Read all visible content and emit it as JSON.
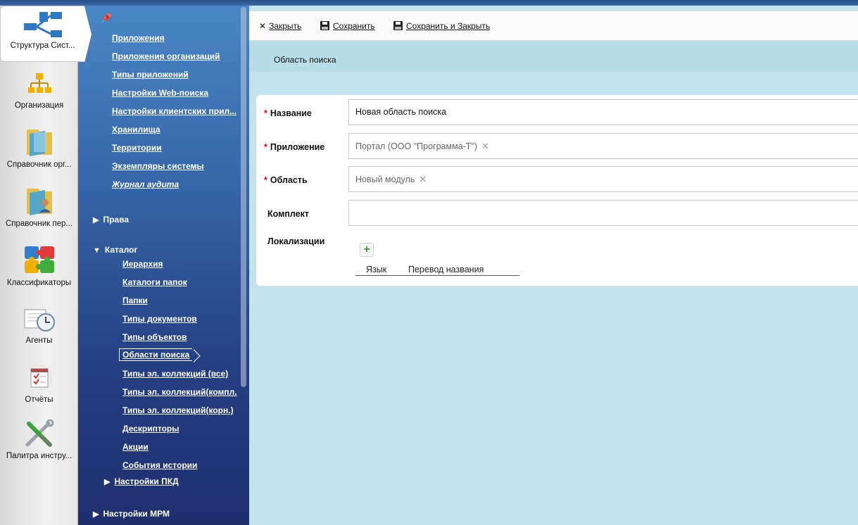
{
  "rail": {
    "items": [
      {
        "label": "Структура Сист...",
        "icon": "system-structure-icon"
      },
      {
        "label": "Организация",
        "icon": "organization-icon"
      },
      {
        "label": "Справочник орг...",
        "icon": "org-directory-icon"
      },
      {
        "label": "Справочник пер...",
        "icon": "personnel-directory-icon"
      },
      {
        "label": "Классификаторы",
        "icon": "classifiers-icon"
      },
      {
        "label": "Агенты",
        "icon": "agents-icon"
      },
      {
        "label": "Отчёты",
        "icon": "reports-icon"
      },
      {
        "label": "Палитра инстру...",
        "icon": "tools-palette-icon"
      }
    ]
  },
  "nav": {
    "top_links": [
      "Приложения",
      "Приложения организаций",
      "Типы приложений",
      "Настройки Web-поиска",
      "Настройки клиентских прил...",
      "Хранилища",
      "Территории",
      "Экземпляры системы"
    ],
    "audit": "Журнал аудита",
    "section_rights": "Права",
    "section_catalog": "Каталог",
    "catalog_links": [
      "Иерархия",
      "Каталоги папок",
      "Папки",
      "Типы документов",
      "Типы объектов",
      "Области поиска",
      "Типы эл. коллекций (все)",
      "Типы эл. коллекций(компл.",
      "Типы эл. коллекций(корн.)",
      "Дескрипторы",
      "Акции",
      "События истории"
    ],
    "subsection_pkd": "Настройки ПКД",
    "section_mrm": "Настройки МРМ"
  },
  "toolbar": {
    "close": "Закрыть",
    "save": "Сохранить",
    "save_close": "Сохранить и Закрыть"
  },
  "breadcrumb": "Область поиска",
  "form": {
    "name_label": "Название",
    "name_value": "Новая область поиска",
    "app_label": "Приложение",
    "app_value": "Портал (ООО \"Программа-Т\")",
    "area_label": "Область",
    "area_value": "Новый модуль",
    "kit_label": "Комплект",
    "kit_value": "",
    "loc_label": "Локализации",
    "loc_col_lang": "Язык",
    "loc_col_translation": "Перевод названия"
  },
  "colors": {
    "accent": "#3565a8",
    "required": "#d00000",
    "background": "#c3e4ee"
  }
}
